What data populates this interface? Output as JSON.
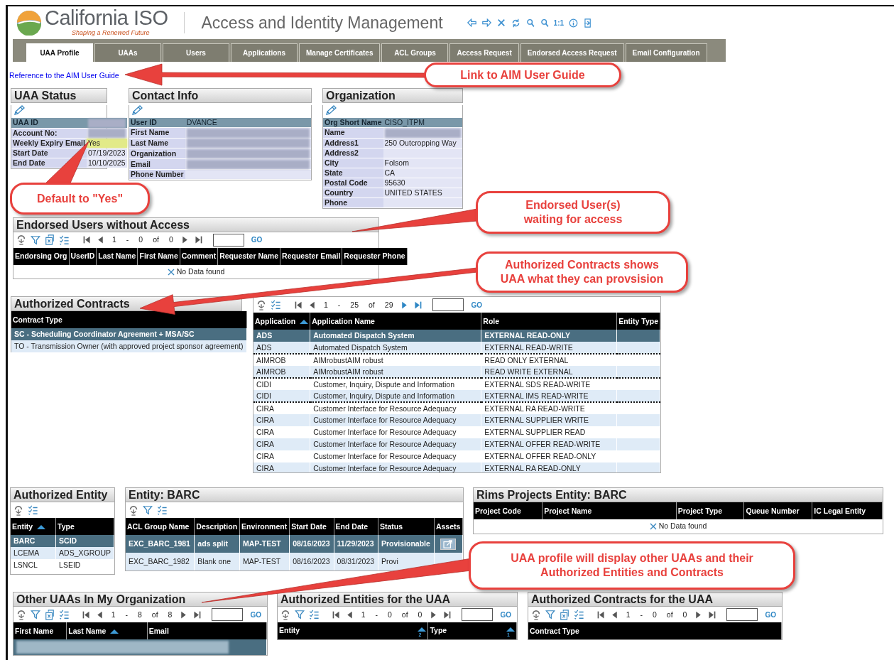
{
  "header": {
    "logo_text": "California ISO",
    "logo_tagline": "Shaping a Renewed Future",
    "title": "Access and Identity Management",
    "toolbar": [
      {
        "kind": "back"
      },
      {
        "kind": "forward"
      },
      {
        "kind": "close"
      },
      {
        "kind": "refresh"
      },
      {
        "kind": "zoom-in"
      },
      {
        "kind": "zoom-out"
      },
      {
        "kind": "actual-size",
        "label": "1:1"
      },
      {
        "kind": "info"
      },
      {
        "kind": "exit"
      }
    ]
  },
  "tabs": [
    {
      "label": "UAA Profile",
      "selected": true
    },
    {
      "label": "UAAs",
      "selected": false
    },
    {
      "label": "Users",
      "selected": false
    },
    {
      "label": "Applications",
      "selected": false
    },
    {
      "label": "Manage Certificates",
      "selected": false
    },
    {
      "label": "ACL Groups",
      "selected": false
    },
    {
      "label": "Access Request",
      "selected": false
    },
    {
      "label": "Endorsed Access Request",
      "selected": false
    },
    {
      "label": "Email Configuration",
      "selected": false
    }
  ],
  "guide_link": "Reference to the AIM User Guide",
  "uaa_status": {
    "title": "UAA Status",
    "fields": [
      {
        "label": "UAA ID",
        "redacted": true,
        "highlighted": true,
        "marked": false
      },
      {
        "label": "Account No:",
        "redacted": true,
        "highlighted": false,
        "marked": false
      },
      {
        "label": "Weekly Expiry Email",
        "value": "Yes",
        "redacted": false,
        "highlighted": false,
        "marked": true
      },
      {
        "label": "Start Date",
        "value": "07/19/2023",
        "redacted": false,
        "highlighted": false,
        "marked": false
      },
      {
        "label": "End Date",
        "value": "10/10/2025",
        "redacted": false,
        "highlighted": false,
        "marked": false
      }
    ]
  },
  "contact_info": {
    "title": "Contact Info",
    "fields": [
      {
        "label": "User ID",
        "value": "DVANCE",
        "redacted": false,
        "highlighted": true
      },
      {
        "label": "First Name",
        "redacted": true,
        "highlighted": false
      },
      {
        "label": "Last Name",
        "redacted": true,
        "highlighted": false
      },
      {
        "label": "Organization",
        "redacted": true,
        "highlighted": false
      },
      {
        "label": "Email",
        "redacted": true,
        "highlighted": false
      },
      {
        "label": "Phone Number",
        "redacted": false,
        "highlighted": false
      }
    ]
  },
  "organization": {
    "title": "Organization",
    "fields": [
      {
        "label": "Org Short Name",
        "value": "CISO_ITPM",
        "redacted": false,
        "highlighted": true
      },
      {
        "label": "Name",
        "redacted": true,
        "highlighted": false
      },
      {
        "label": "Address1",
        "value": "250 Outcropping Way",
        "redacted": false,
        "highlighted": false
      },
      {
        "label": "Address2",
        "redacted": false,
        "highlighted": false
      },
      {
        "label": "City",
        "value": "Folsom",
        "redacted": false,
        "highlighted": false
      },
      {
        "label": "State",
        "value": "CA",
        "redacted": false,
        "highlighted": false
      },
      {
        "label": "Postal Code",
        "value": "95630",
        "redacted": false,
        "highlighted": false
      },
      {
        "label": "Country",
        "value": "UNITED STATES",
        "redacted": false,
        "highlighted": false
      },
      {
        "label": "Phone",
        "redacted": false,
        "highlighted": false
      }
    ]
  },
  "endorsed_users": {
    "title": "Endorsed Users without Access",
    "tools": [
      {
        "kind": "refresh"
      },
      {
        "kind": "filter"
      },
      {
        "kind": "export"
      },
      {
        "kind": "columns"
      }
    ],
    "pager": {
      "parts": [
        "1",
        "-",
        "0",
        "of",
        "0"
      ],
      "can_go_back": false,
      "can_go_forward": false,
      "go": "GO"
    },
    "columns": [
      "Endorsing Org",
      "UserID",
      "Last Name",
      "First Name",
      "Comment",
      "Requester Name",
      "Requester Email",
      "Requester Phone"
    ],
    "empty_message": "No Data found"
  },
  "authorized_contracts": {
    "title": "Authorized Contracts",
    "columns": [
      "Contract Type"
    ],
    "rows": [
      {
        "cells": [
          "SC - Scheduling Coordinator Agreement + MSA/SC"
        ],
        "selected": true
      },
      {
        "cells": [
          "TO - Transmission Owner (with approved project sponsor agreement)"
        ],
        "selected": false
      }
    ]
  },
  "applications": {
    "tools": [
      {
        "kind": "refresh"
      },
      {
        "kind": "columns"
      }
    ],
    "pager": {
      "parts": [
        "1",
        "-",
        "25",
        "of",
        "29"
      ],
      "can_go_back": false,
      "can_go_forward": true,
      "go": "GO"
    },
    "columns": [
      {
        "label": "Application",
        "sorted": true
      },
      {
        "label": "Application Name",
        "sorted": false
      },
      {
        "label": "Role",
        "sorted": false
      },
      {
        "label": "Entity Type",
        "sorted": false
      }
    ],
    "rows": [
      {
        "cells": [
          "ADS",
          "Automated Dispatch System",
          "EXTERNAL READ-ONLY"
        ],
        "selected": true,
        "group_start": false
      },
      {
        "cells": [
          "ADS",
          "Automated Dispatch System",
          "EXTERNAL READ-WRITE"
        ],
        "selected": false,
        "group_start": false
      },
      {
        "cells": [
          "AIMROB",
          "AIMrobustAIM robust",
          "READ ONLY EXTERNAL"
        ],
        "selected": false,
        "group_start": true
      },
      {
        "cells": [
          "AIMROB",
          "AIMrobustAIM robust",
          "READ WRITE EXTERNAL"
        ],
        "selected": false,
        "group_start": false
      },
      {
        "cells": [
          "CIDI",
          "Customer, Inquiry, Dispute and Information",
          "EXTERNAL SDS READ-WRITE"
        ],
        "selected": false,
        "group_start": true
      },
      {
        "cells": [
          "CIDI",
          "Customer, Inquiry, Dispute and Information",
          "EXTERNAL IMS READ-WRITE"
        ],
        "selected": false,
        "group_start": false
      },
      {
        "cells": [
          "CIRA",
          "Customer Interface for Resource Adequacy",
          "EXTERNAL RA READ-WRITE"
        ],
        "selected": false,
        "group_start": true
      },
      {
        "cells": [
          "CIRA",
          "Customer Interface for Resource Adequacy",
          "EXTERNAL SUPPLIER WRITE"
        ],
        "selected": false,
        "group_start": false
      },
      {
        "cells": [
          "CIRA",
          "Customer Interface for Resource Adequacy",
          "EXTERNAL SUPPLIER READ"
        ],
        "selected": false,
        "group_start": false
      },
      {
        "cells": [
          "CIRA",
          "Customer Interface for Resource Adequacy",
          "EXTERNAL OFFER READ-WRITE"
        ],
        "selected": false,
        "group_start": false
      },
      {
        "cells": [
          "CIRA",
          "Customer Interface for Resource Adequacy",
          "EXTERNAL OFFER READ-ONLY"
        ],
        "selected": false,
        "group_start": false
      },
      {
        "cells": [
          "CIRA",
          "Customer Interface for Resource Adequacy",
          "EXTERNAL RA READ-ONLY"
        ],
        "selected": false,
        "group_start": false
      }
    ]
  },
  "authorized_entity": {
    "title": "Authorized Entity",
    "tools": [
      {
        "kind": "refresh"
      },
      {
        "kind": "columns"
      }
    ],
    "columns": [
      {
        "label": "Entity",
        "sorted": true
      },
      {
        "label": "Type",
        "sorted": false
      }
    ],
    "rows": [
      {
        "cells": [
          "BARC",
          "SCID"
        ],
        "selected": true
      },
      {
        "cells": [
          "LCEMA",
          "ADS_XGROUP"
        ],
        "selected": false
      },
      {
        "cells": [
          "LSNCL",
          "LSEID"
        ],
        "selected": false
      }
    ]
  },
  "entity_barc": {
    "title": "Entity: BARC",
    "tools": [
      {
        "kind": "refresh"
      },
      {
        "kind": "filter"
      },
      {
        "kind": "columns"
      }
    ],
    "columns": [
      "ACL Group Name",
      "Description",
      "Environment",
      "Start Date",
      "End Date",
      "Status",
      "Assets"
    ],
    "rows": [
      {
        "cells": [
          "EXC_BARC_1981",
          "ads split",
          "MAP-TEST",
          "08/16/2023",
          "11/29/2023",
          "Provisionable"
        ],
        "assets": true,
        "selected": true
      },
      {
        "cells": [
          "EXC_BARC_1982",
          "Blank one",
          "MAP-TEST",
          "08/16/2023",
          "08/31/2023",
          "Provi"
        ],
        "assets": false,
        "selected": false
      }
    ]
  },
  "rims_projects": {
    "title": "Rims Projects Entity: BARC",
    "columns": [
      "Project Code",
      "Project Name",
      "Project Type",
      "Queue Number",
      "IC Legal Entity"
    ],
    "empty_message": "No Data found"
  },
  "other_uaas": {
    "title": "Other UAAs In My Organization",
    "tools": [
      {
        "kind": "refresh"
      },
      {
        "kind": "filter"
      },
      {
        "kind": "export"
      },
      {
        "kind": "columns"
      }
    ],
    "pager": {
      "parts": [
        "1",
        "-",
        "8",
        "of",
        "8"
      ],
      "can_go_back": false,
      "can_go_forward": false,
      "go": "GO"
    },
    "columns": [
      {
        "label": "First Name",
        "sorted": false
      },
      {
        "label": "Last Name",
        "sorted": true
      },
      {
        "label": "Email",
        "sorted": false
      }
    ],
    "rows": [
      {
        "redacted": true,
        "selected": true
      }
    ]
  },
  "authorized_entities_uaa": {
    "title": "Authorized Entities for the UAA",
    "tools": [
      {
        "kind": "refresh"
      },
      {
        "kind": "filter"
      },
      {
        "kind": "columns"
      }
    ],
    "pager": {
      "parts": [
        "1",
        "-",
        "0",
        "of",
        "0"
      ],
      "can_go_back": false,
      "can_go_forward": false,
      "go": "GO"
    },
    "columns": [
      {
        "label": "Entity",
        "sorted": true,
        "sort_rank": "2"
      },
      {
        "label": "Type",
        "sorted": true,
        "sort_rank": "1"
      }
    ]
  },
  "authorized_contracts_uaa": {
    "title": "Authorized Contracts for the UAA",
    "tools": [
      {
        "kind": "refresh"
      },
      {
        "kind": "filter"
      },
      {
        "kind": "export"
      },
      {
        "kind": "columns"
      }
    ],
    "pager": {
      "parts": [
        "1",
        "-",
        "0",
        "of",
        "0"
      ],
      "can_go_back": false,
      "can_go_forward": false,
      "go": "GO"
    },
    "columns": [
      "Contract Type"
    ]
  },
  "callouts": [
    "Link to AIM User Guide",
    "Default to \"Yes\"",
    "Endorsed User(s) waiting for access",
    "Authorized Contracts shows UAA what they can provsision",
    "UAA profile will display other UAAs  and their Authorized Entities and Contracts"
  ]
}
